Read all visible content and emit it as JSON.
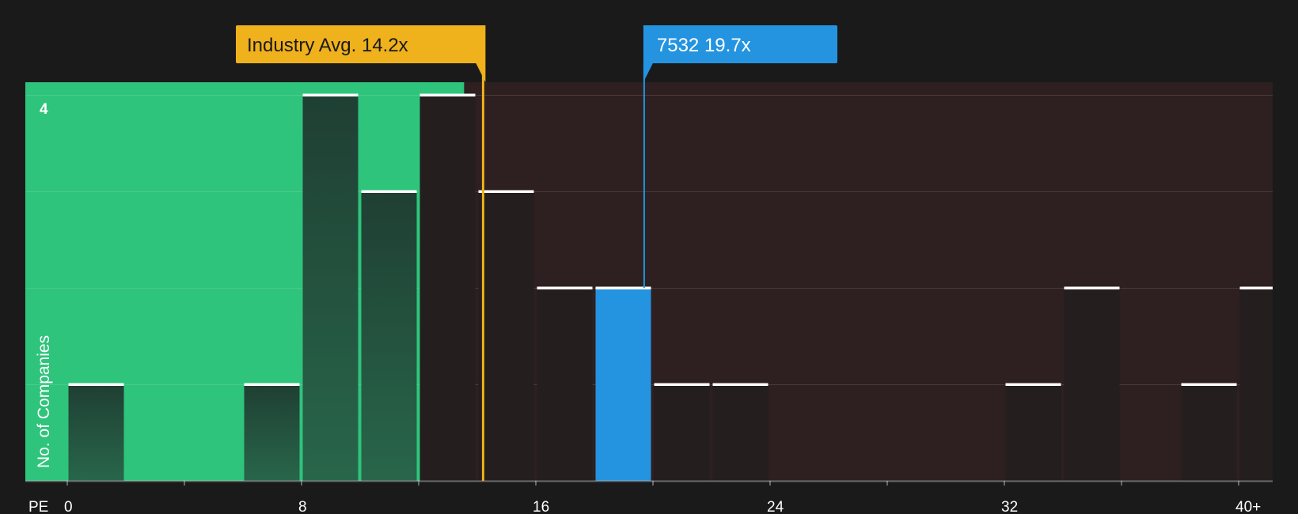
{
  "chart_data": {
    "type": "bar",
    "xaxis_prefix": "PE",
    "ylabel": "No. of Companies",
    "y_top_label": "4",
    "ylim": [
      0,
      4
    ],
    "x_range": [
      0,
      41
    ],
    "x_ticks": [
      {
        "value": 0,
        "label": "0"
      },
      {
        "value": 8,
        "label": "8"
      },
      {
        "value": 16,
        "label": "16"
      },
      {
        "value": 24,
        "label": "24"
      },
      {
        "value": 32,
        "label": "32"
      },
      {
        "value": 40,
        "label": "40+"
      }
    ],
    "bins": [
      {
        "x0": 0,
        "x1": 2,
        "count": 1
      },
      {
        "x0": 6,
        "x1": 8,
        "count": 1
      },
      {
        "x0": 8,
        "x1": 10,
        "count": 4
      },
      {
        "x0": 10,
        "x1": 12,
        "count": 3
      },
      {
        "x0": 12,
        "x1": 14,
        "count": 4
      },
      {
        "x0": 14,
        "x1": 16,
        "count": 3
      },
      {
        "x0": 16,
        "x1": 18,
        "count": 2
      },
      {
        "x0": 18,
        "x1": 20,
        "count": 2,
        "highlight": true
      },
      {
        "x0": 20,
        "x1": 22,
        "count": 1
      },
      {
        "x0": 22,
        "x1": 24,
        "count": 1
      },
      {
        "x0": 32,
        "x1": 34,
        "count": 1
      },
      {
        "x0": 34,
        "x1": 36,
        "count": 2
      },
      {
        "x0": 38,
        "x1": 40,
        "count": 1
      },
      {
        "x0": 40,
        "x1": 42,
        "count": 2
      }
    ],
    "industry_avg": {
      "value": 14.2,
      "label": "Industry Avg. 14.2x"
    },
    "company": {
      "value": 19.7,
      "label": "7532 19.7x"
    },
    "colors": {
      "background": "#1a1a1a",
      "undervalued_zone": "#2fc47c",
      "overvalued_zone": "#2e1f20",
      "bar_in_green": "#23463a",
      "bar_in_red": "#241e1e",
      "bar_highlight": "#2494e0",
      "industry_marker": "#efb11c",
      "company_marker": "#2494e0",
      "bar_cap": "#ffffff",
      "grid": "#4a3a3a"
    }
  }
}
